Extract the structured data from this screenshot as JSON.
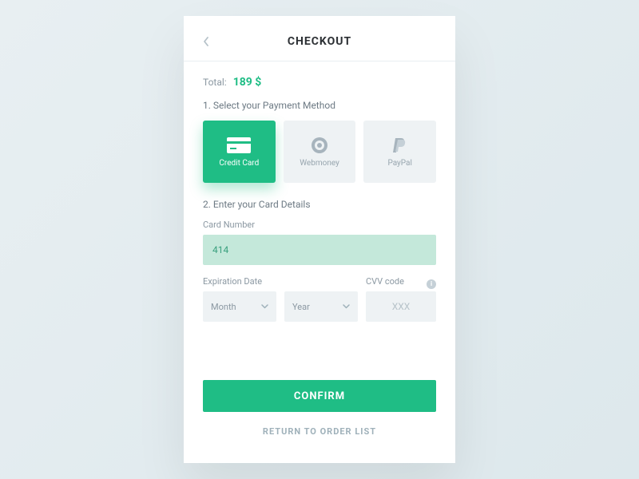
{
  "header": {
    "title": "CHECKOUT"
  },
  "total": {
    "label": "Total:",
    "value": "189 $"
  },
  "step1": {
    "label": "1. Select your Payment Method",
    "methods": [
      {
        "label": "Credit Card"
      },
      {
        "label": "Webmoney"
      },
      {
        "label": "PayPal"
      }
    ]
  },
  "step2": {
    "label": "2. Enter your Card Details",
    "card_number_label": "Card Number",
    "card_number_value": "414",
    "expiration_label": "Expiration Date",
    "month_placeholder": "Month",
    "year_placeholder": "Year",
    "cvv_label": "CVV code",
    "cvv_placeholder": "XXX"
  },
  "actions": {
    "confirm": "CONFIRM",
    "return": "RETURN TO ORDER LIST"
  }
}
